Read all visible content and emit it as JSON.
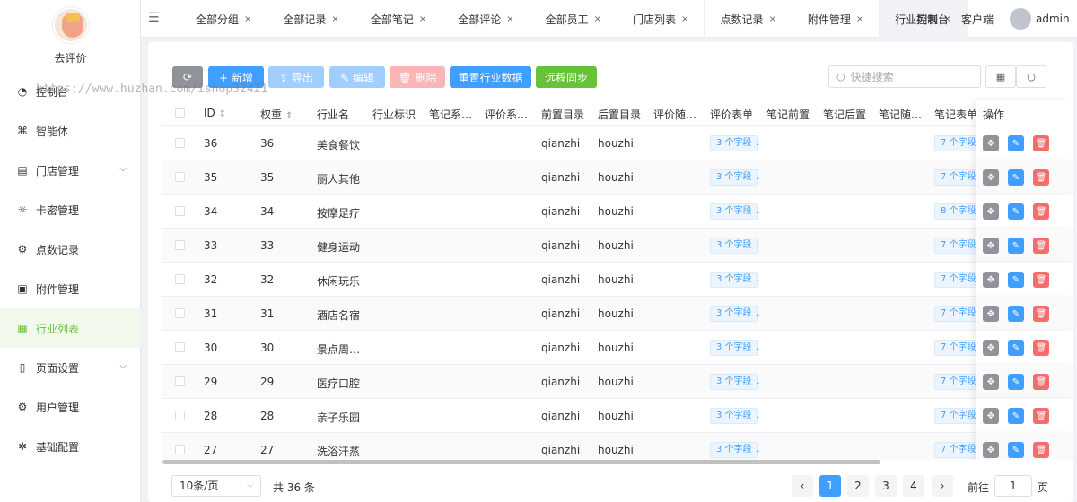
{
  "brand": {
    "name": "去评价"
  },
  "watermark": "https://www.huzhan.com/ishop32421",
  "sidebar": {
    "items": [
      {
        "label": "控制台",
        "icon": "gauge-icon",
        "glyph": "◔",
        "arrow": ""
      },
      {
        "label": "智能体",
        "icon": "gamepad-icon",
        "glyph": "⌘",
        "arrow": ""
      },
      {
        "label": "门店管理",
        "icon": "store-icon",
        "glyph": "▤",
        "arrow": "⌵"
      },
      {
        "label": "卡密管理",
        "icon": "sun-icon",
        "glyph": "☼",
        "arrow": ""
      },
      {
        "label": "点数记录",
        "icon": "gear-icon",
        "glyph": "⚙",
        "arrow": ""
      },
      {
        "label": "附件管理",
        "icon": "image-icon",
        "glyph": "▣",
        "arrow": ""
      },
      {
        "label": "行业列表",
        "icon": "list-icon",
        "glyph": "▦",
        "arrow": "",
        "active": true
      },
      {
        "label": "页面设置",
        "icon": "phone-icon",
        "glyph": "▯",
        "arrow": "⌵"
      },
      {
        "label": "用户管理",
        "icon": "gear-icon",
        "glyph": "⚙",
        "arrow": ""
      },
      {
        "label": "基础配置",
        "icon": "cog-icon",
        "glyph": "✲",
        "arrow": ""
      }
    ]
  },
  "topbar": {
    "tabs": [
      {
        "label": "全部分组"
      },
      {
        "label": "全部记录"
      },
      {
        "label": "全部笔记"
      },
      {
        "label": "全部评论"
      },
      {
        "label": "全部员工"
      },
      {
        "label": "门店列表"
      },
      {
        "label": "点数记录"
      },
      {
        "label": "附件管理"
      },
      {
        "label": "行业列表",
        "active": true
      }
    ],
    "close": "×",
    "links": [
      "控制台",
      "客户端"
    ],
    "user": "admin"
  },
  "toolbar": {
    "refresh": "⟳",
    "add": "+ 新增",
    "export": "⇪ 导出",
    "edit": "✎ 编辑",
    "delete": "🗑 删除",
    "reset": "重置行业数据",
    "sync": "远程同步",
    "search_placeholder": "快捷搜索",
    "colors": {
      "primary": "#409eff",
      "success": "#67c23a",
      "danger": "#f56c6c",
      "info": "#909399"
    }
  },
  "table": {
    "columns": [
      "ID",
      "权重",
      "行业名",
      "行业标识",
      "笔记系…",
      "评价系…",
      "前置目录",
      "后置目录",
      "评价随…",
      "评价表单",
      "笔记前置",
      "笔记后置",
      "笔记随…",
      "笔记表单",
      "操作"
    ],
    "sort_mark": "⇕",
    "rows": [
      {
        "id": "36",
        "weight": "36",
        "name": "美食餐饮",
        "pre": "qianzhi",
        "post": "houzhi",
        "rform": "3 个字段",
        "nform": "7 个字段"
      },
      {
        "id": "35",
        "weight": "35",
        "name": "丽人其他",
        "pre": "qianzhi",
        "post": "houzhi",
        "rform": "3 个字段",
        "nform": "7 个字段"
      },
      {
        "id": "34",
        "weight": "34",
        "name": "按摩足疗",
        "pre": "qianzhi",
        "post": "houzhi",
        "rform": "3 个字段",
        "nform": "8 个字段"
      },
      {
        "id": "33",
        "weight": "33",
        "name": "健身运动",
        "pre": "qianzhi",
        "post": "houzhi",
        "rform": "3 个字段",
        "nform": "7 个字段"
      },
      {
        "id": "32",
        "weight": "32",
        "name": "休闲玩乐",
        "pre": "qianzhi",
        "post": "houzhi",
        "rform": "3 个字段",
        "nform": "7 个字段"
      },
      {
        "id": "31",
        "weight": "31",
        "name": "酒店名宿",
        "pre": "qianzhi",
        "post": "houzhi",
        "rform": "3 个字段",
        "nform": "7 个字段"
      },
      {
        "id": "30",
        "weight": "30",
        "name": "景点周…",
        "pre": "qianzhi",
        "post": "houzhi",
        "rform": "3 个字段",
        "nform": "7 个字段"
      },
      {
        "id": "29",
        "weight": "29",
        "name": "医疗口腔",
        "pre": "qianzhi",
        "post": "houzhi",
        "rform": "3 个字段",
        "nform": "7 个字段"
      },
      {
        "id": "28",
        "weight": "28",
        "name": "亲子乐园",
        "pre": "qianzhi",
        "post": "houzhi",
        "rform": "3 个字段",
        "nform": "7 个字段"
      },
      {
        "id": "27",
        "weight": "27",
        "name": "洗浴汗蒸",
        "pre": "qianzhi",
        "post": "houzhi",
        "rform": "3 个字段",
        "nform": "7 个字段"
      }
    ]
  },
  "pagination": {
    "page_size": "10条/页",
    "total": "共 36 条",
    "pages": [
      "1",
      "2",
      "3",
      "4"
    ],
    "current": "1",
    "prev": "‹",
    "next": "›",
    "goto_prefix": "前往",
    "goto_value": "1",
    "goto_suffix": "页"
  }
}
